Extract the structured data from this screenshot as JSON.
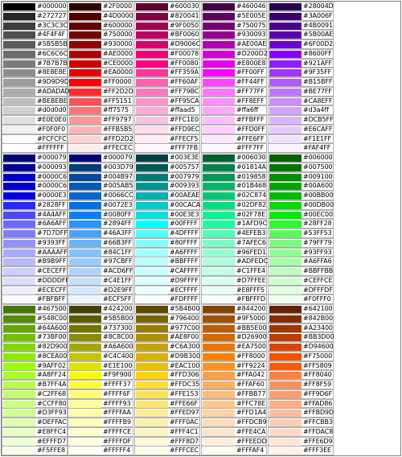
{
  "palette": [
    {
      "columns": [
        [
          "#000000",
          "#272727",
          "#3C3C3C",
          "#4F4F4F",
          "#5B5B5B",
          "#6C6C6C",
          "#7B7B7B",
          "#8E8E8E",
          "#9D9D9D",
          "#ADADAD",
          "#BEBEBE",
          "#d0d0d0",
          "#E0E0E0",
          "#F0F0F0",
          "#FCFCFC",
          "#FFFFFF"
        ],
        [
          "#2F0000",
          "#4D0000",
          "#600000",
          "#750000",
          "#930000",
          "#AE0000",
          "#CE0000",
          "#EA0000",
          "#FF0000",
          "#FF2D2D",
          "#FF5151",
          "#ff7575",
          "#FF9797",
          "#FFB5B5",
          "#FFD2D2",
          "#FFECEC"
        ],
        [
          "#600030",
          "#820041",
          "#9F0050",
          "#BF0060",
          "#D9006C",
          "#F00078",
          "#FF0080",
          "#FF359A",
          "#FF60AF",
          "#FF79BC",
          "#FF95CA",
          "#ffaad5",
          "#FFC1E0",
          "#FFD9EC",
          "#FFECF5",
          "#FFF7FB"
        ],
        [
          "#460046",
          "#5E005E",
          "#750075",
          "#930093",
          "#AE00AE",
          "#D200D2",
          "#E800E8",
          "#FF00FF",
          "#FF44FF",
          "#FF77FF",
          "#FF8EFF",
          "#ffa6ff",
          "#FFBFFF",
          "#FFD0FF",
          "#FFE6FF",
          "#FFF7FF"
        ],
        [
          "#28004D",
          "#3A006F",
          "#4B0091",
          "#5B00AE",
          "#6F00D2",
          "#8600FF",
          "#921AFF",
          "#9F35FF",
          "#B15BFF",
          "#BE77FF",
          "#CA8EFF",
          "#d3a4ff",
          "#DCB5FF",
          "#E6CAFF",
          "#F1E1FF",
          "#FAF4FF"
        ]
      ]
    },
    {
      "columns": [
        [
          "#000079",
          "#000093",
          "#0000C6",
          "#0000C6",
          "#0000E3",
          "#2828FF",
          "#4A4AFF",
          "#6A6AFF",
          "#7D7DFF",
          "#9393FF",
          "#AAAAFF",
          "#B9B9FF",
          "#CECEFF",
          "#DDDDFF",
          "#ECECFF",
          "#FBFBFF"
        ],
        [
          "#000079",
          "#003D79",
          "#004B97",
          "#005AB5",
          "#0066CC",
          "#0072E3",
          "#0080FF",
          "#2894FF",
          "#46A3FF",
          "#66B3FF",
          "#84C1FF",
          "#97CBFF",
          "#ACD6FF",
          "#C4E1FF",
          "#D2E9FF",
          "#ECF5FF"
        ],
        [
          "#003E3E",
          "#005757",
          "#007979",
          "#009393",
          "#00AEAE",
          "#00CACA",
          "#00E3E3",
          "#00FFFF",
          "#4DFFFF",
          "#80FFFF",
          "#A6FFFF",
          "#BBFFFF",
          "#CAFFFF",
          "#D9FFFF",
          "#ECFFFF",
          "#FDFFFF"
        ],
        [
          "#006030",
          "#01814A",
          "#019858",
          "#01B468",
          "#02C874",
          "#02DF82",
          "#02F78E",
          "#1AFD9C",
          "#4EFEB3",
          "#7AFEC6",
          "#96FED1",
          "#ADFEDC",
          "#C1FFE4",
          "#D7FFEE",
          "#E8FFF5",
          "#FBFFFD"
        ],
        [
          "#006000",
          "#007500",
          "#009100",
          "#00A600",
          "#00BB00",
          "#00DB00",
          "#00EC00",
          "#28FF28",
          "#53FF53",
          "#79FF79",
          "#93FF93",
          "#A6FFA6",
          "#BBFFBB",
          "#CEFFCE",
          "#DFFFDF",
          "#F0FFF0"
        ]
      ]
    },
    {
      "columns": [
        [
          "#467500",
          "#548C00",
          "#64A600",
          "#73BF00",
          "#82D900",
          "#8CEA00",
          "#9AFF02",
          "#A8FF24",
          "#B7FF4A",
          "#C2FF68",
          "#CCFF80",
          "#D3FF93",
          "#DEFFAC",
          "#E8FFC4",
          "#EFFFD7",
          "#F5FFE8"
        ],
        [
          "#424200",
          "#5B5B00",
          "#737300",
          "#8C8C00",
          "#A6A600",
          "#C4C400",
          "#E1E100",
          "#F9F900",
          "#FFFF37",
          "#FFFF6F",
          "#FFFF93",
          "#FFFFAA",
          "#FFFFB9",
          "#FFFFCE",
          "#FFFFDF",
          "#FFFFF4"
        ],
        [
          "#5B4B00",
          "#796400",
          "#977C00",
          "#AE8F00",
          "#C6A300",
          "#D9B300",
          "#EAC100",
          "#FFD306",
          "#FFDC35",
          "#FFE153",
          "#FFE66F",
          "#FFED97",
          "#FFF0AC",
          "#FFF4C1",
          "#FFF8D7",
          "#FFFCEC"
        ],
        [
          "#844200",
          "#9F5000",
          "#BB5E00",
          "#D26900",
          "#EA7500",
          "#FF8000",
          "#FF9224",
          "#FFA042",
          "#FFAF60",
          "#FFBB77",
          "#FFC78E",
          "#FFD1A4",
          "#FFDCB9",
          "#FFE4CA",
          "#FFEEDD",
          "#FFFAF4"
        ],
        [
          "#642100",
          "#842B00",
          "#A23400",
          "#BB3D00",
          "#D94600",
          "#F75000",
          "#FF5809",
          "#FF8040",
          "#FF8F59",
          "#FF9D6F",
          "#FFAD86",
          "#FFBD9D",
          "#FFCBB3",
          "#FFDAC8",
          "#FFE6D9",
          "#FFF3EE"
        ]
      ]
    }
  ]
}
